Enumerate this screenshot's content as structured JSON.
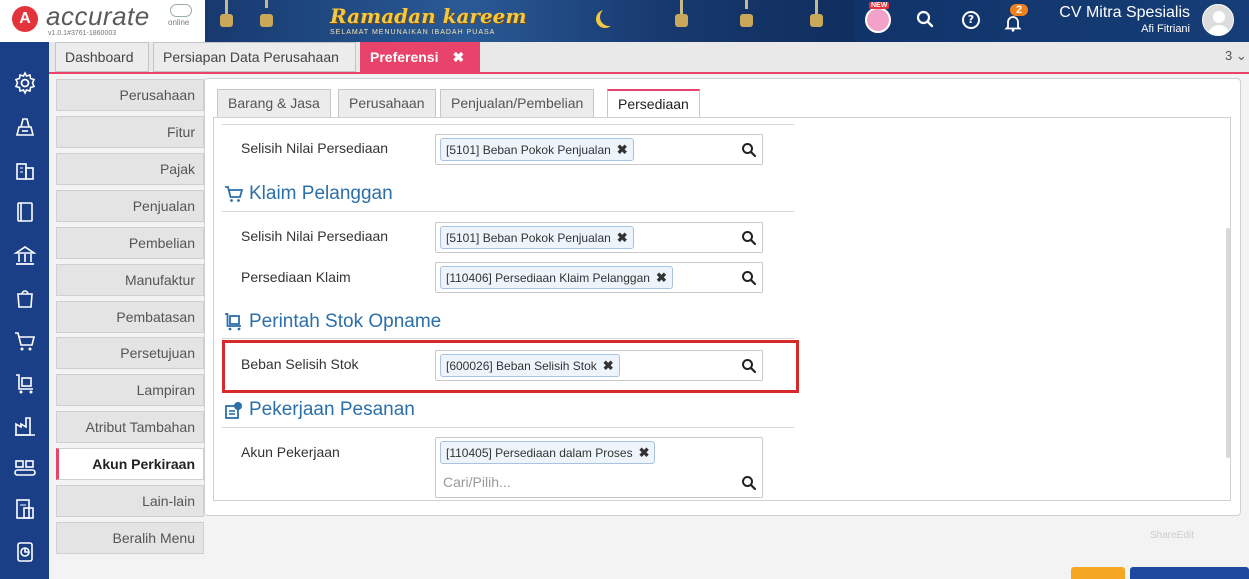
{
  "app": {
    "logo_letter": "A",
    "logo_name": "accurate",
    "logo_suffix": "online",
    "version": "v1.0.1#3761-1860003"
  },
  "banner": {
    "title": "Ramadan kareem",
    "subtitle": "SELAMAT MENUNAIKAN IBADAH PUASA"
  },
  "header": {
    "new_badge": "NEW",
    "notification_count": "2",
    "company": "CV Mitra Spesialis",
    "user": "Afi Fitriani"
  },
  "tabs": [
    {
      "label": "Dashboard"
    },
    {
      "label": "Persiapan Data Perusahaan"
    },
    {
      "label": "Preferensi",
      "close": "✖"
    }
  ],
  "tab_count": "3 ⌄",
  "side_menu": [
    {
      "label": "Perusahaan"
    },
    {
      "label": "Fitur"
    },
    {
      "label": "Pajak"
    },
    {
      "label": "Penjualan"
    },
    {
      "label": "Pembelian"
    },
    {
      "label": "Manufaktur"
    },
    {
      "label": "Pembatasan"
    },
    {
      "label": "Persetujuan"
    },
    {
      "label": "Lampiran"
    },
    {
      "label": "Atribut Tambahan"
    },
    {
      "label": "Akun Perkiraan"
    },
    {
      "label": "Lain-lain"
    },
    {
      "label": "Beralih Menu"
    }
  ],
  "sub_tabs": [
    {
      "label": "Barang & Jasa"
    },
    {
      "label": "Perusahaan"
    },
    {
      "label": "Penjualan/Pembelian"
    },
    {
      "label": "Persediaan"
    }
  ],
  "sections": {
    "top": {
      "fields": [
        {
          "label": "Selisih Nilai Persediaan",
          "value": "[5101] Beban Pokok Penjualan"
        }
      ]
    },
    "klaim": {
      "title": "Klaim Pelanggan",
      "icon": "cart-icon",
      "fields": [
        {
          "label": "Selisih Nilai Persediaan",
          "value": "[5101] Beban Pokok Penjualan"
        },
        {
          "label": "Persediaan Klaim",
          "value": "[110406] Persediaan Klaim Pelanggan"
        }
      ]
    },
    "opname": {
      "title": "Perintah Stok Opname",
      "icon": "clipboard-cart-icon",
      "fields": [
        {
          "label": "Beban Selisih Stok",
          "value": "[600026] Beban Selisih Stok"
        }
      ]
    },
    "pesanan": {
      "title": "Pekerjaan Pesanan",
      "icon": "order-work-icon",
      "fields": [
        {
          "label": "Akun Pekerjaan",
          "value": "[110405] Persediaan dalam Proses",
          "placeholder": "Cari/Pilih..."
        }
      ]
    }
  },
  "chip_remove": "✖",
  "watermark": "ShareEdit",
  "colors": {
    "brand_blue": "#1a3f86",
    "accent_pink": "#e8436a",
    "section_blue": "#2b6fa8",
    "highlight_red": "#d62a2a"
  }
}
